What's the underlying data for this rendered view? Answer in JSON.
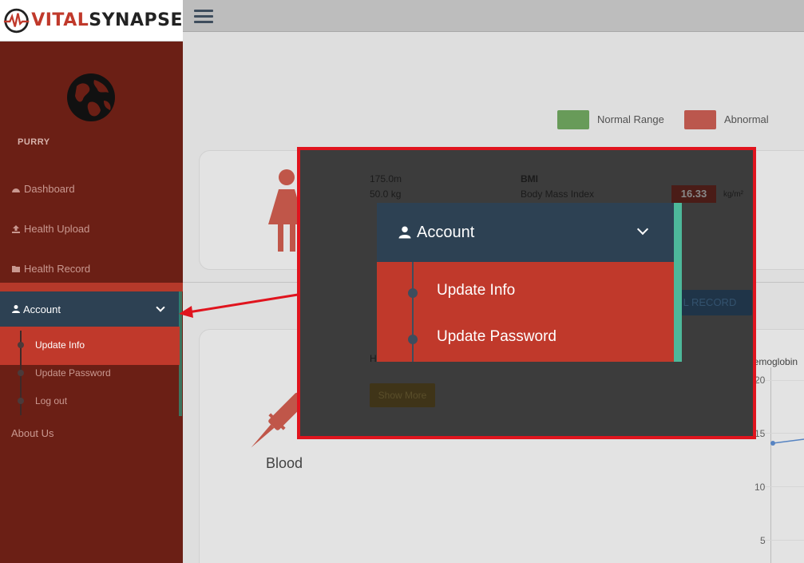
{
  "brand": {
    "part1": "VITAL",
    "part2": "SYNAPSE"
  },
  "sidebar": {
    "username": "PURRY",
    "items": [
      {
        "label": "Dashboard",
        "icon": "dashboard-icon"
      },
      {
        "label": "Health Upload",
        "icon": "upload-icon"
      },
      {
        "label": "Health Record",
        "icon": "folder-icon"
      }
    ],
    "account": {
      "label": "Account",
      "icon": "user-icon",
      "submenu": [
        "Update Info",
        "Update Password",
        "Log out"
      ]
    },
    "about": "About Us"
  },
  "legend": {
    "normal": "Normal Range",
    "abnormal": "Abnormal",
    "normal_color": "#4e8a3c",
    "abnormal_color": "#b03a2e"
  },
  "profile": {
    "height": "175.0m",
    "weight": "50.0 kg",
    "bmi_title": "BMI",
    "bmi_desc": "Body Mass Index",
    "bmi_value": "16.33",
    "bmi_unit": "kg/m²"
  },
  "records": {
    "button": "L RECORD",
    "show_more": "Show More",
    "category": "Blood",
    "h_prefix": "H",
    "chart_title": "Hemoglobin",
    "y_ticks": [
      "20",
      "15",
      "10",
      "5"
    ]
  },
  "zoom": {
    "account": "Account",
    "items": [
      "Update Info",
      "Update Password"
    ]
  },
  "colors": {
    "sidebar": "#6b1f15",
    "active": "#c0392b",
    "header": "#2d4153",
    "callout_border": "#e0141e",
    "accent": "#4db89a"
  }
}
